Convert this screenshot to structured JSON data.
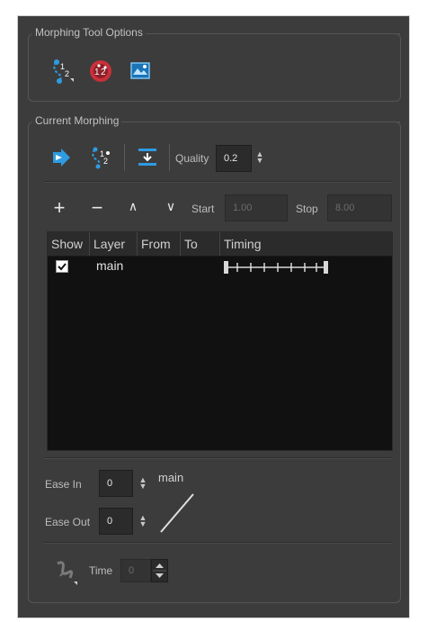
{
  "tool_options": {
    "title": "Morphing Tool Options",
    "icons": [
      "morphing-tool-icon",
      "hint-point-icon",
      "show-morphing-icon"
    ]
  },
  "current_morphing": {
    "title": "Current Morphing",
    "toolbar_icons": [
      "morph-arrow-icon",
      "morph-hint-icon",
      "import-icon"
    ],
    "quality_label": "Quality",
    "quality_value": "0.2",
    "row_tools": {
      "add": "+",
      "remove": "−",
      "move_up": "∧",
      "move_down": "∨"
    },
    "start_label": "Start",
    "start_value": "1.00",
    "stop_label": "Stop",
    "stop_value": "8.00",
    "table": {
      "columns": [
        "Show",
        "Layer",
        "From",
        "To",
        "Timing"
      ],
      "rows": [
        {
          "show": true,
          "layer": "main",
          "from": "",
          "to": "",
          "timing_ticks": 7
        }
      ]
    },
    "ease_in_label": "Ease In",
    "ease_in_value": "0",
    "ease_out_label": "Ease Out",
    "ease_out_value": "0",
    "ease_curve_label": "main",
    "time_label": "Time",
    "time_value": "0"
  },
  "colors": {
    "panel_bg": "#3c3c3c",
    "table_bg": "#111111",
    "accent_blue": "#2f9be0",
    "accent_red": "#c8303a"
  }
}
